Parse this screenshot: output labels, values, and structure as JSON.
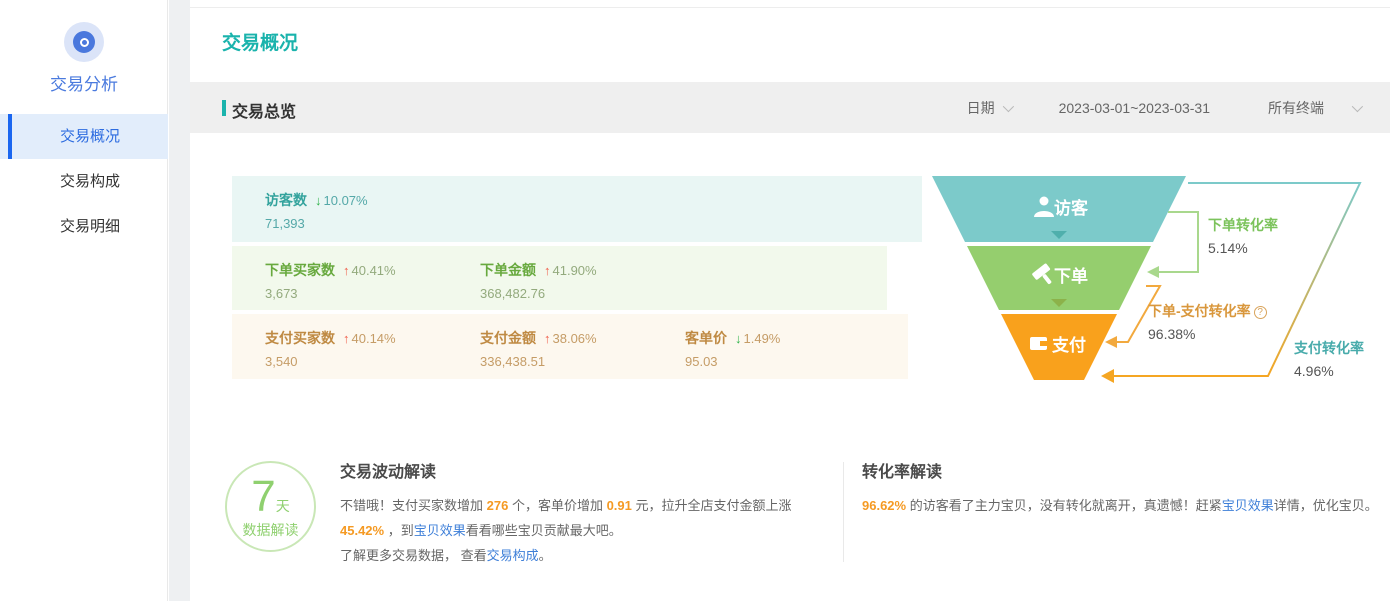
{
  "sidebar": {
    "title": "交易分析",
    "items": [
      {
        "label": "交易概况",
        "active": true
      },
      {
        "label": "交易构成",
        "active": false
      },
      {
        "label": "交易明细",
        "active": false
      }
    ]
  },
  "header": {
    "title": "交易概况"
  },
  "toolbar": {
    "section_title": "交易总览",
    "date_label": "日期",
    "date_range": "2023-03-01~2023-03-31",
    "terminal": "所有终端"
  },
  "metrics": {
    "rows": [
      {
        "tone": "teal",
        "cells": [
          {
            "label": "访客数",
            "trend": "down",
            "pct": "10.07%",
            "value": "71,393"
          }
        ]
      },
      {
        "tone": "green",
        "cells": [
          {
            "label": "下单买家数",
            "trend": "up",
            "pct": "40.41%",
            "value": "3,673"
          },
          {
            "label": "下单金额",
            "trend": "up",
            "pct": "41.90%",
            "value": "368,482.76"
          }
        ]
      },
      {
        "tone": "orange",
        "cells": [
          {
            "label": "支付买家数",
            "trend": "up",
            "pct": "40.14%",
            "value": "3,540"
          },
          {
            "label": "支付金额",
            "trend": "up",
            "pct": "38.06%",
            "value": "336,438.51"
          },
          {
            "label": "客单价",
            "trend": "down",
            "pct": "1.49%",
            "value": "95.03"
          }
        ]
      }
    ]
  },
  "chart_data": {
    "type": "funnel",
    "title": "",
    "stages": [
      {
        "label": "访客",
        "icon": "user-icon",
        "color": "#7ccaca"
      },
      {
        "label": "下单",
        "icon": "gavel-icon",
        "color": "#95ce6e"
      },
      {
        "label": "支付",
        "icon": "wallet-icon",
        "color": "#f9a11c"
      }
    ],
    "rates": [
      {
        "label": "下单转化率",
        "value": "5.14%"
      },
      {
        "label": "下单-支付转化率",
        "value": "96.38%",
        "help": true
      },
      {
        "label": "支付转化率",
        "value": "4.96%"
      }
    ]
  },
  "insights": {
    "badge": {
      "big": "7",
      "small": "天",
      "caption": "数据解读"
    },
    "left": {
      "title": "交易波动解读",
      "para1": [
        {
          "t": "不错哦！支付买家数增加 "
        },
        {
          "t": "276",
          "c": "orange"
        },
        {
          "t": " 个，客单价增加 "
        },
        {
          "t": "0.91",
          "c": "orange"
        },
        {
          "t": " 元，拉升全店支付金额上涨 "
        },
        {
          "t": "45.42%",
          "c": "orange"
        },
        {
          "t": " ，到"
        },
        {
          "t": "宝贝效果",
          "c": "link"
        },
        {
          "t": "看看哪些宝贝贡献最大吧。"
        }
      ],
      "para2": [
        {
          "t": "了解更多交易数据， 查看"
        },
        {
          "t": "交易构成",
          "c": "link"
        },
        {
          "t": "。"
        }
      ]
    },
    "right": {
      "title": "转化率解读",
      "para1": [
        {
          "t": " "
        },
        {
          "t": "96.62%",
          "c": "orange"
        },
        {
          "t": " 的访客看了主力宝贝，没有转化就离开，真遗憾！赶紧"
        },
        {
          "t": "宝贝效果",
          "c": "link"
        },
        {
          "t": "详情，优化宝贝。"
        }
      ]
    }
  },
  "colors": {
    "accent_teal": "#1ab3ac",
    "active_blue": "#1a66f0",
    "funnel_teal": "#7ccaca",
    "funnel_green": "#95ce6e",
    "funnel_orange": "#f9a11c",
    "up_red": "#f0614d",
    "down_green": "#2eb34a",
    "highlight_orange": "#f59a23",
    "link_blue": "#3e7fd8"
  }
}
